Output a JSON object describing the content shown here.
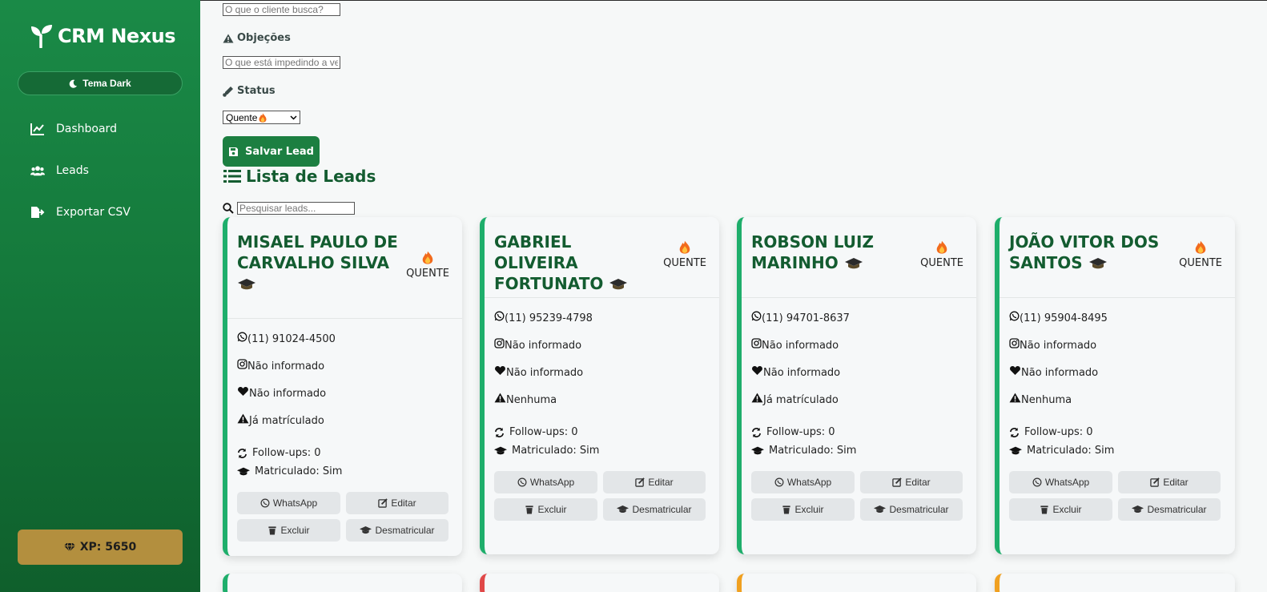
{
  "app": {
    "title": "CRM Nexus"
  },
  "sidebar": {
    "theme_label": "Tema Dark",
    "items": [
      {
        "label": "Dashboard",
        "icon": "chart-line-icon"
      },
      {
        "label": "Leads",
        "icon": "users-icon"
      },
      {
        "label": "Exportar CSV",
        "icon": "file-export-icon"
      }
    ],
    "xp_label": "XP: 5650"
  },
  "form": {
    "busca_placeholder": "O que o cliente busca?",
    "objecoes_label": "Objeções",
    "objecoes_placeholder": "O que está impedindo a ver",
    "status_label": "Status",
    "status_value": "Quente",
    "save_label": "Salvar Lead"
  },
  "list": {
    "title": "Lista de Leads",
    "search_placeholder": "Pesquisar leads..."
  },
  "leads": [
    {
      "name": "MISAEL PAULO DE CARVALHO SILVA",
      "status": "QUENTE",
      "phone": "(11) 91024-4500",
      "instagram": "Não informado",
      "interest": "Não informado",
      "objection": "Já matrículado",
      "followups": "Follow-ups: 0",
      "enrolled": "Matriculado: Sim"
    },
    {
      "name": "GABRIEL OLIVEIRA FORTUNATO",
      "status": "QUENTE",
      "phone": "(11) 95239-4798",
      "instagram": "Não informado",
      "interest": "Não informado",
      "objection": "Nenhuma",
      "followups": "Follow-ups: 0",
      "enrolled": "Matriculado: Sim"
    },
    {
      "name": "ROBSON LUIZ MARINHO",
      "status": "QUENTE",
      "phone": "(11) 94701-8637",
      "instagram": "Não informado",
      "interest": "Não informado",
      "objection": "Já matrículado",
      "followups": "Follow-ups: 0",
      "enrolled": "Matriculado: Sim"
    },
    {
      "name": "JOÃO VITOR DOS SANTOS",
      "status": "QUENTE",
      "phone": "(11) 95904-8495",
      "instagram": "Não informado",
      "interest": "Não informado",
      "objection": "Nenhuma",
      "followups": "Follow-ups: 0",
      "enrolled": "Matriculado: Sim"
    }
  ],
  "card_actions": {
    "whatsapp": "WhatsApp",
    "edit": "Editar",
    "delete": "Excluir",
    "unenroll": "Desmatricular"
  },
  "colors": {
    "sidebar": "#157a3c",
    "accent": "#1c7f41",
    "card_border": "#1eae6b",
    "xp_badge": "#b38f3e",
    "next_row_borders": [
      "#1eae6b",
      "#e04848",
      "#f0a020",
      "#f0a020"
    ]
  }
}
